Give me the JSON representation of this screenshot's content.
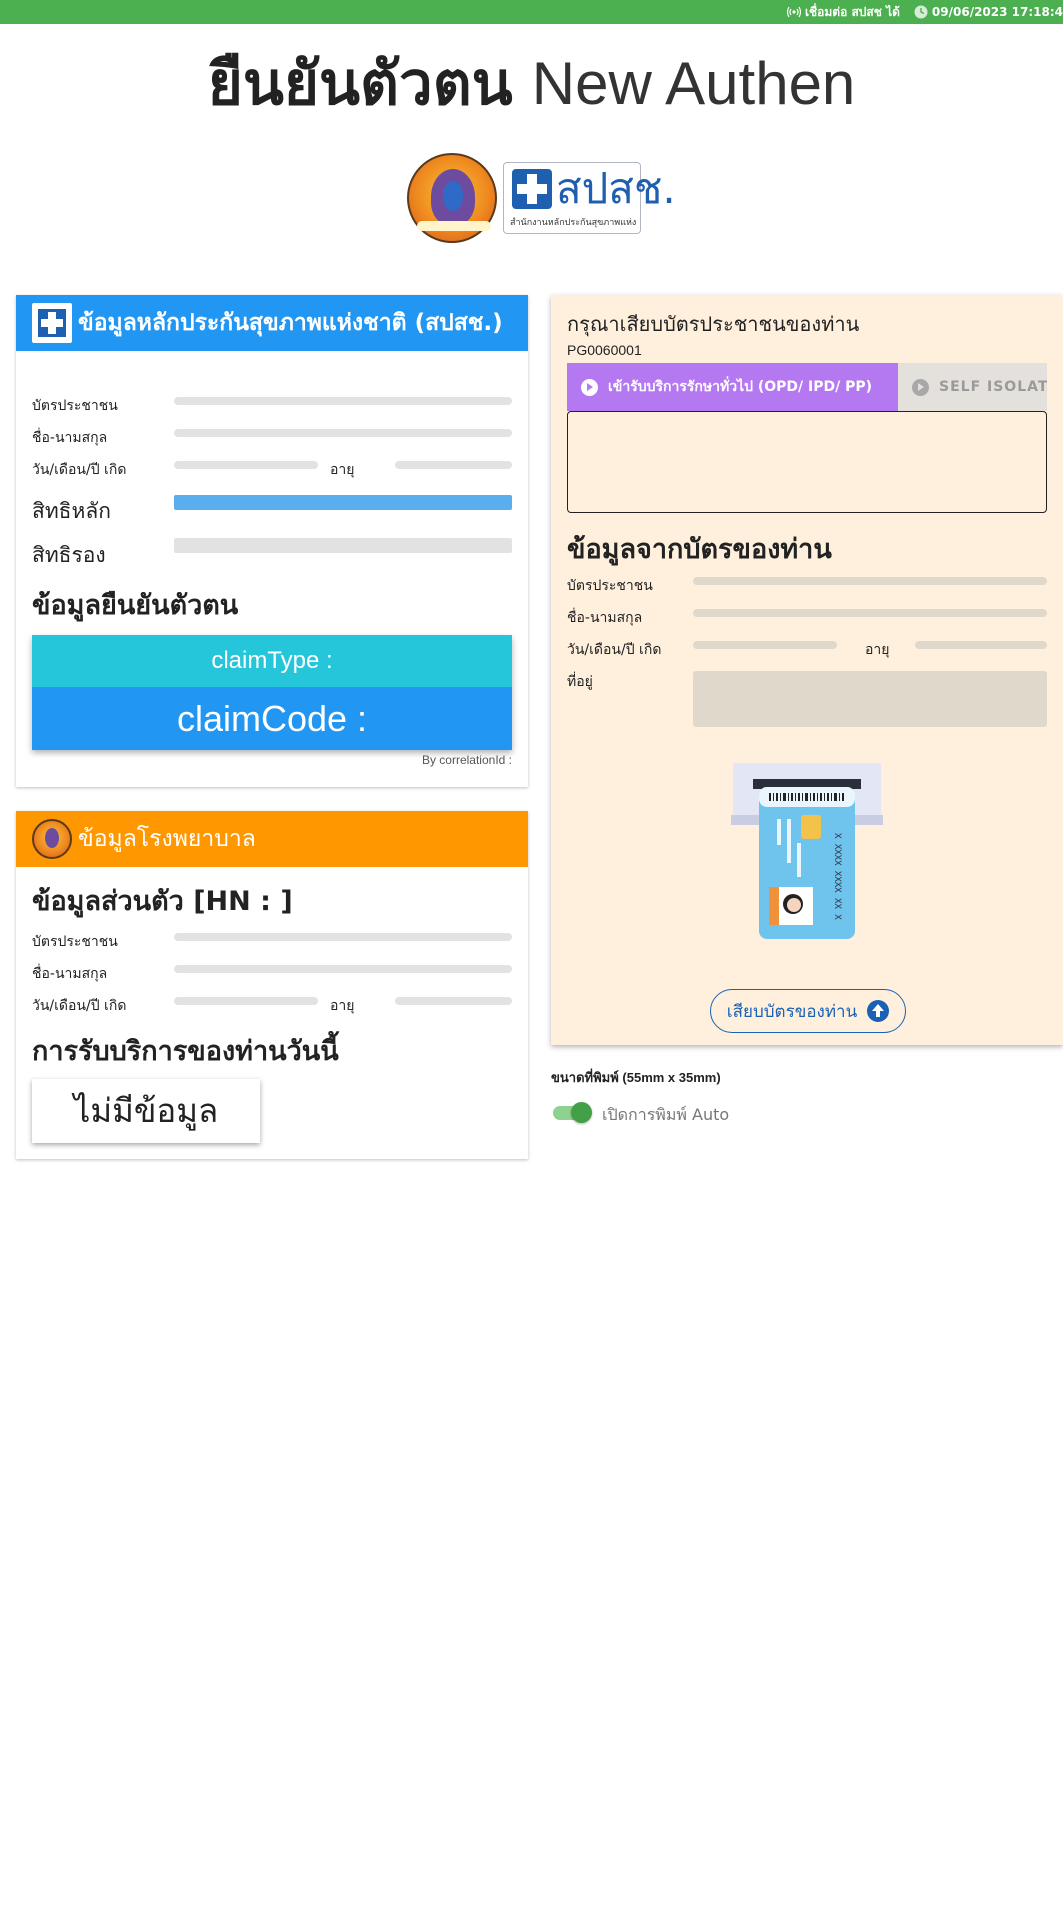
{
  "status_bar": {
    "connection": "เชื่อมต่อ สปสช ได้",
    "datetime": "09/06/2023 17:18:4"
  },
  "page_title": {
    "thai": "ยืนยันตัวตน",
    "english": "New Authen"
  },
  "logos": {
    "nhso_name": "สปสช.",
    "nhso_subtitle": "สำนักงานหลักประกันสุขภาพแห่งชาติ"
  },
  "nhso_card": {
    "header": "ข้อมูลหลักประกันสุขภาพแห่งชาติ (สปสช.)",
    "header_color": "#2196f3",
    "labels": {
      "id_card": "บัตรประชาชน",
      "name": "ชื่อ-นามสกุล",
      "dob": "วัน/เดือน/ปี เกิด",
      "age": "อายุ",
      "main_right": "สิทธิหลัก",
      "sub_right": "สิทธิรอง"
    },
    "auth_section_title": "ข้อมูลยืนยันตัวตน",
    "claim_type": "claimType :",
    "claim_code": "claimCode :",
    "correlation": "By correlationId :"
  },
  "hospital_card": {
    "header": "ข้อมูลโรงพยาบาล",
    "header_color": "#ff9800",
    "personal_title": "ข้อมูลส่วนตัว [HN : ]",
    "labels": {
      "id_card": "บัตรประชาชน",
      "name": "ชื่อ-นามสกุล",
      "dob": "วัน/เดือน/ปี เกิด",
      "age": "อายุ"
    },
    "service_title": "การรับบริการของท่านวันนี้",
    "no_data": "ไม่มีข้อมูล"
  },
  "card_reader": {
    "prompt": "กรุณาเสียบบัตรประชาชนของท่าน",
    "code": "PG0060001",
    "tabs": [
      {
        "label": "เข้ารับบริการรักษาทั่วไป (OPD/ IPD/ PP)",
        "active": true
      },
      {
        "label": "SELF ISOLATIO",
        "active": false
      }
    ],
    "card_info_title": "ข้อมูลจากบัตรของท่าน",
    "labels": {
      "id_card": "บัตรประชาชน",
      "name": "ชื่อ-นามสกุล",
      "dob": "วัน/เดือน/ปี เกิด",
      "age": "อายุ",
      "address": "ที่อยู่"
    },
    "insert_button": "เสียบบัตรของท่าน",
    "background_color": "#fff0dd"
  },
  "print_settings": {
    "size_label": "ขนาดที่พิมพ์ (55mm x 35mm)",
    "auto_print_label": "เปิดการพิมพ์ Auto",
    "auto_print_enabled": true
  }
}
